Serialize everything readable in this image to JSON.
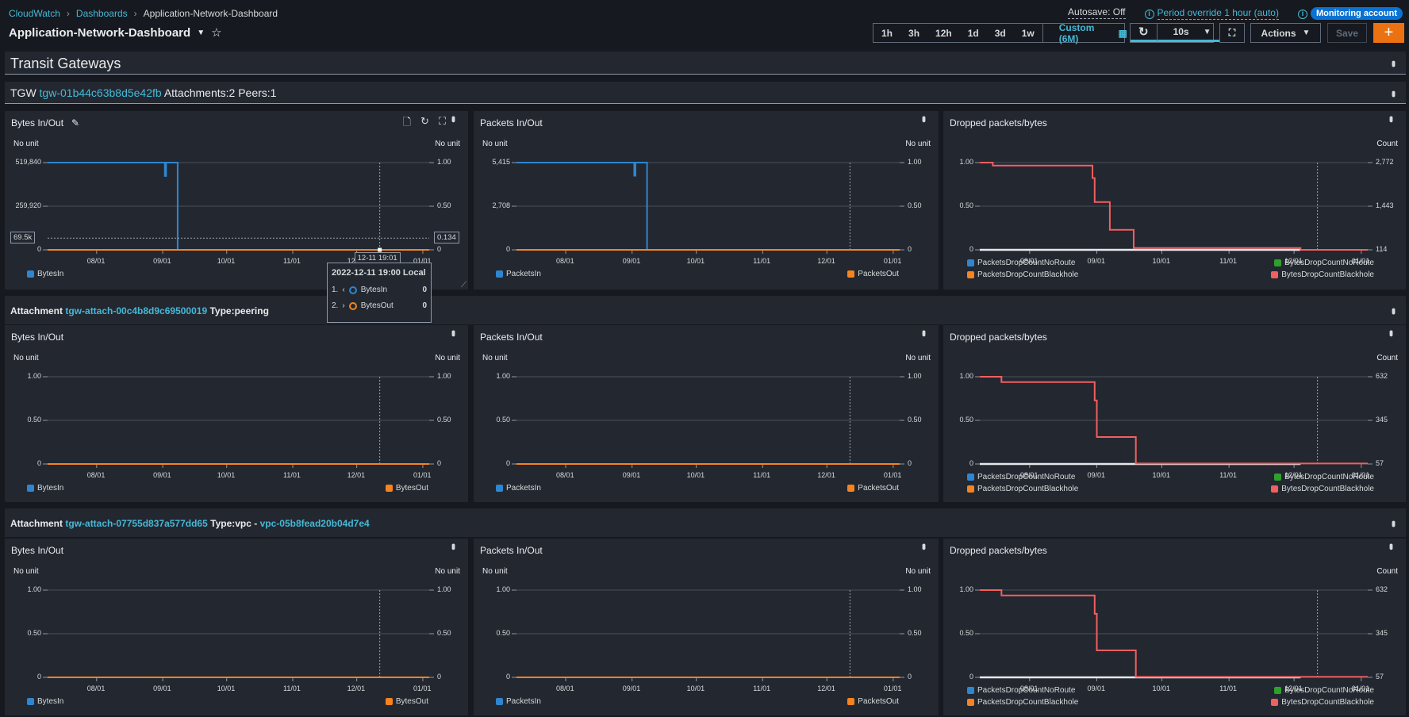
{
  "header": {
    "breadcrumb": [
      "CloudWatch",
      "Dashboards",
      "Application-Network-Dashboard"
    ],
    "title": "Application-Network-Dashboard",
    "autosave": "Autosave: Off",
    "period_override": "Period override 1 hour (auto)",
    "monitoring_account": "Monitoring account"
  },
  "toolbar": {
    "ranges": [
      "1h",
      "3h",
      "12h",
      "1d",
      "3d",
      "1w"
    ],
    "custom": "Custom (6M)",
    "refresh_interval": "10s",
    "actions": "Actions",
    "save": "Save",
    "add": "+"
  },
  "sections": {
    "transit_title": "Transit Gateways",
    "tgw": {
      "prefix": "TGW",
      "id": "tgw-01b44c63b8d5e42fb",
      "details": "Attachments:2 Peers:1"
    }
  },
  "colors": {
    "accent_link": "#44b9d6",
    "primary": "#0972d3",
    "add_button": "#ec7211",
    "series_blue": "#2f86d0",
    "series_orange": "#f5831f",
    "series_green": "#2ea02c",
    "series_red": "#f25f5f"
  },
  "crosshair": {
    "left_value": "69.5k",
    "right_value": "0.134",
    "time": "12-11 19:01"
  },
  "tooltip": {
    "title": "2022-12-11 19:00 Local",
    "items": [
      {
        "index": "1.",
        "name": "BytesIn",
        "value": "0"
      },
      {
        "index": "2.",
        "name": "BytesOut",
        "value": "0"
      }
    ]
  },
  "rows": [
    {
      "header": null,
      "widgets": [
        {
          "kind": "io",
          "title": "Bytes In/Out",
          "left_unit": "No unit",
          "right_unit": "No unit",
          "left_ylim": [
            0,
            519840
          ],
          "left_ticks": [
            "519,840",
            "259,920",
            "0"
          ],
          "right_ylim": [
            0,
            1
          ],
          "right_ticks": [
            "1.00",
            "0.50",
            "0"
          ],
          "x_ticks": [
            "08/01",
            "09/01",
            "10/01",
            "11/01",
            "12/01",
            "01/01"
          ],
          "series": [
            {
              "name": "BytesIn",
              "color": "#2f86d0",
              "axis": "left",
              "points": [
                [
                  "2022-07-09",
                  519840
                ],
                [
                  "2022-09-02",
                  440000
                ],
                [
                  "2022-09-02T14:00",
                  519840
                ],
                [
                  "2022-09-08",
                  0
                ],
                [
                  "2023-01-04",
                  0
                ]
              ]
            },
            {
              "name": "BytesOut",
              "color": "#f5831f",
              "axis": "right",
              "points": [
                [
                  "2022-07-09",
                  0
                ],
                [
                  "2023-01-04",
                  0
                ]
              ]
            }
          ]
        },
        {
          "kind": "io",
          "title": "Packets In/Out",
          "left_unit": "No unit",
          "right_unit": "No unit",
          "left_ylim": [
            0,
            5415
          ],
          "left_ticks": [
            "5,415",
            "2,708",
            "0"
          ],
          "right_ylim": [
            0,
            1
          ],
          "right_ticks": [
            "1.00",
            "0.50",
            "0"
          ],
          "x_ticks": [
            "08/01",
            "09/01",
            "10/01",
            "11/01",
            "12/01",
            "01/01"
          ],
          "series": [
            {
              "name": "PacketsIn",
              "color": "#2f86d0",
              "axis": "left",
              "points": [
                [
                  "2022-07-09",
                  5415
                ],
                [
                  "2022-09-02",
                  4600
                ],
                [
                  "2022-09-02T14:00",
                  5415
                ],
                [
                  "2022-09-08",
                  0
                ],
                [
                  "2023-01-04",
                  0
                ]
              ]
            },
            {
              "name": "PacketsOut",
              "color": "#f5831f",
              "axis": "right",
              "points": [
                [
                  "2022-07-09",
                  0
                ],
                [
                  "2023-01-04",
                  0
                ]
              ]
            }
          ]
        },
        {
          "kind": "drop",
          "title": "Dropped packets/bytes",
          "left_unit": "",
          "right_unit": "Count",
          "left_ylim": [
            0,
            1
          ],
          "left_ticks": [
            "1.00",
            "0.50",
            "0"
          ],
          "right_ylim": [
            114,
            2772
          ],
          "right_ticks": [
            "2,772",
            "1,443",
            "114"
          ],
          "x_ticks": [
            "08/01",
            "09/01",
            "10/01",
            "11/01",
            "12/01",
            "01/01"
          ],
          "series": [
            {
              "name": "PacketsDropCountNoRoute",
              "color": "#2f86d0",
              "axis": "left",
              "points": []
            },
            {
              "name": "BytesDropCountNoRoute",
              "color": "#2ea02c",
              "axis": "left",
              "points": []
            },
            {
              "name": "PacketsDropCountBlackhole",
              "color": "#f5831f",
              "axis": "left",
              "points": []
            },
            {
              "name": "BytesDropCountBlackhole",
              "color": "#f25f5f",
              "axis": "right",
              "points": [
                [
                  "2022-07-09",
                  2772
                ],
                [
                  "2022-07-15",
                  2680
                ],
                [
                  "2022-08-29",
                  2680
                ],
                [
                  "2022-08-30",
                  2300
                ],
                [
                  "2022-08-31",
                  1570
                ],
                [
                  "2022-09-07",
                  725
                ],
                [
                  "2022-09-18",
                  170
                ],
                [
                  "2022-12-04",
                  114
                ],
                [
                  "2023-01-04",
                  114
                ]
              ]
            }
          ]
        }
      ]
    },
    {
      "header": {
        "label": "Attachment",
        "id": "tgw-attach-00c4b8d9c69500019",
        "type": "Type:peering",
        "vpc": ""
      },
      "widgets": [
        {
          "kind": "io",
          "title": "Bytes In/Out",
          "left_unit": "No unit",
          "right_unit": "No unit",
          "left_ylim": [
            0,
            1
          ],
          "left_ticks": [
            "1.00",
            "0.50",
            "0"
          ],
          "right_ylim": [
            0,
            1
          ],
          "right_ticks": [
            "1.00",
            "0.50",
            "0"
          ],
          "x_ticks": [
            "08/01",
            "09/01",
            "10/01",
            "11/01",
            "12/01",
            "01/01"
          ],
          "series": [
            {
              "name": "BytesIn",
              "color": "#2f86d0",
              "axis": "left",
              "points": [
                [
                  "2022-07-09",
                  0
                ],
                [
                  "2023-01-04",
                  0
                ]
              ]
            },
            {
              "name": "BytesOut",
              "color": "#f5831f",
              "axis": "right",
              "points": [
                [
                  "2022-07-09",
                  0
                ],
                [
                  "2023-01-04",
                  0
                ]
              ]
            }
          ]
        },
        {
          "kind": "io",
          "title": "Packets In/Out",
          "left_unit": "No unit",
          "right_unit": "No unit",
          "left_ylim": [
            0,
            1
          ],
          "left_ticks": [
            "1.00",
            "0.50",
            "0"
          ],
          "right_ylim": [
            0,
            1
          ],
          "right_ticks": [
            "1.00",
            "0.50",
            "0"
          ],
          "x_ticks": [
            "08/01",
            "09/01",
            "10/01",
            "11/01",
            "12/01",
            "01/01"
          ],
          "series": [
            {
              "name": "PacketsIn",
              "color": "#2f86d0",
              "axis": "left",
              "points": [
                [
                  "2022-07-09",
                  0
                ],
                [
                  "2023-01-04",
                  0
                ]
              ]
            },
            {
              "name": "PacketsOut",
              "color": "#f5831f",
              "axis": "right",
              "points": [
                [
                  "2022-07-09",
                  0
                ],
                [
                  "2023-01-04",
                  0
                ]
              ]
            }
          ]
        },
        {
          "kind": "drop",
          "title": "Dropped packets/bytes",
          "left_unit": "",
          "right_unit": "Count",
          "left_ylim": [
            0,
            1
          ],
          "left_ticks": [
            "1.00",
            "0.50",
            "0"
          ],
          "right_ylim": [
            57,
            632
          ],
          "right_ticks": [
            "632",
            "345",
            "57"
          ],
          "x_ticks": [
            "08/01",
            "09/01",
            "10/01",
            "11/01",
            "12/01",
            "01/01"
          ],
          "series": [
            {
              "name": "PacketsDropCountNoRoute",
              "color": "#2f86d0",
              "axis": "left",
              "points": []
            },
            {
              "name": "BytesDropCountNoRoute",
              "color": "#2ea02c",
              "axis": "left",
              "points": []
            },
            {
              "name": "PacketsDropCountBlackhole",
              "color": "#f5831f",
              "axis": "left",
              "points": []
            },
            {
              "name": "BytesDropCountBlackhole",
              "color": "#f25f5f",
              "axis": "right",
              "points": [
                [
                  "2022-07-09",
                  632
                ],
                [
                  "2022-07-19",
                  597
                ],
                [
                  "2022-08-30",
                  597
                ],
                [
                  "2022-08-31",
                  476
                ],
                [
                  "2022-09-01",
                  235
                ],
                [
                  "2022-09-19",
                  60
                ],
                [
                  "2023-01-04",
                  60
                ]
              ]
            }
          ]
        }
      ]
    },
    {
      "header": {
        "label": "Attachment",
        "id": "tgw-attach-07755d837a577dd65",
        "type": "Type:vpc -",
        "vpc": "vpc-05b8fead20b04d7e4"
      },
      "widgets": [
        {
          "kind": "io",
          "title": "Bytes In/Out",
          "left_unit": "No unit",
          "right_unit": "No unit",
          "left_ylim": [
            0,
            1
          ],
          "left_ticks": [
            "1.00",
            "0.50",
            "0"
          ],
          "right_ylim": [
            0,
            1
          ],
          "right_ticks": [
            "1.00",
            "0.50",
            "0"
          ],
          "x_ticks": [
            "08/01",
            "09/01",
            "10/01",
            "11/01",
            "12/01",
            "01/01"
          ],
          "series": [
            {
              "name": "BytesIn",
              "color": "#2f86d0",
              "axis": "left",
              "points": [
                [
                  "2022-07-09",
                  0
                ],
                [
                  "2023-01-04",
                  0
                ]
              ]
            },
            {
              "name": "BytesOut",
              "color": "#f5831f",
              "axis": "right",
              "points": [
                [
                  "2022-07-09",
                  0
                ],
                [
                  "2023-01-04",
                  0
                ]
              ]
            }
          ]
        },
        {
          "kind": "io",
          "title": "Packets In/Out",
          "left_unit": "No unit",
          "right_unit": "No unit",
          "left_ylim": [
            0,
            1
          ],
          "left_ticks": [
            "1.00",
            "0.50",
            "0"
          ],
          "right_ylim": [
            0,
            1
          ],
          "right_ticks": [
            "1.00",
            "0.50",
            "0"
          ],
          "x_ticks": [
            "08/01",
            "09/01",
            "10/01",
            "11/01",
            "12/01",
            "01/01"
          ],
          "series": [
            {
              "name": "PacketsIn",
              "color": "#2f86d0",
              "axis": "left",
              "points": [
                [
                  "2022-07-09",
                  0
                ],
                [
                  "2023-01-04",
                  0
                ]
              ]
            },
            {
              "name": "PacketsOut",
              "color": "#f5831f",
              "axis": "right",
              "points": [
                [
                  "2022-07-09",
                  0
                ],
                [
                  "2023-01-04",
                  0
                ]
              ]
            }
          ]
        },
        {
          "kind": "drop",
          "title": "Dropped packets/bytes",
          "left_unit": "",
          "right_unit": "Count",
          "left_ylim": [
            0,
            1
          ],
          "left_ticks": [
            "1.00",
            "0.50",
            "0"
          ],
          "right_ylim": [
            57,
            632
          ],
          "right_ticks": [
            "632",
            "345",
            "57"
          ],
          "x_ticks": [
            "08/01",
            "09/01",
            "10/01",
            "11/01",
            "12/01",
            "01/01"
          ],
          "series": [
            {
              "name": "PacketsDropCountNoRoute",
              "color": "#2f86d0",
              "axis": "left",
              "points": []
            },
            {
              "name": "BytesDropCountNoRoute",
              "color": "#2ea02c",
              "axis": "left",
              "points": []
            },
            {
              "name": "PacketsDropCountBlackhole",
              "color": "#f5831f",
              "axis": "left",
              "points": []
            },
            {
              "name": "BytesDropCountBlackhole",
              "color": "#f25f5f",
              "axis": "right",
              "points": [
                [
                  "2022-07-09",
                  632
                ],
                [
                  "2022-07-19",
                  597
                ],
                [
                  "2022-08-30",
                  597
                ],
                [
                  "2022-08-31",
                  476
                ],
                [
                  "2022-09-01",
                  235
                ],
                [
                  "2022-09-19",
                  60
                ],
                [
                  "2023-01-04",
                  60
                ]
              ]
            }
          ]
        }
      ]
    }
  ],
  "x_range": [
    "2022-07-09",
    "2023-01-04"
  ],
  "x_tick_dates": [
    "2022-08-01",
    "2022-09-01",
    "2022-10-01",
    "2022-11-01",
    "2022-12-01",
    "2023-01-01"
  ],
  "cursor_time": "2022-12-11T19:00"
}
